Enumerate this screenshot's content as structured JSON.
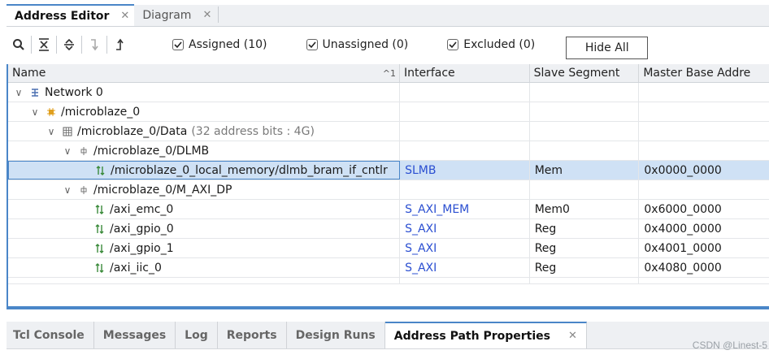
{
  "top_tabs": [
    {
      "label": "Address Editor",
      "active": true
    },
    {
      "label": "Diagram",
      "active": false
    }
  ],
  "toolbar": {
    "checkboxes": [
      {
        "label": "Assigned (10)",
        "checked": true
      },
      {
        "label": "Unassigned (0)",
        "checked": true
      },
      {
        "label": "Excluded (0)",
        "checked": true
      }
    ],
    "hide_all_label": "Hide All"
  },
  "table": {
    "columns": [
      "Name",
      "Interface",
      "Slave Segment",
      "Master Base Addre"
    ],
    "sort_indicator": "^1",
    "rows": [
      {
        "name": "Network 0",
        "interface": "",
        "segment": "",
        "address": ""
      },
      {
        "name": "/microblaze_0",
        "interface": "",
        "segment": "",
        "address": ""
      },
      {
        "name": "/microblaze_0/Data",
        "extra": "(32 address bits : 4G)",
        "interface": "",
        "segment": "",
        "address": ""
      },
      {
        "name": "/microblaze_0/DLMB",
        "interface": "",
        "segment": "",
        "address": ""
      },
      {
        "name": "/microblaze_0_local_memory/dlmb_bram_if_cntlr",
        "interface": "SLMB",
        "segment": "Mem",
        "address": "0x0000_0000"
      },
      {
        "name": "/microblaze_0/M_AXI_DP",
        "interface": "",
        "segment": "",
        "address": ""
      },
      {
        "name": "/axi_emc_0",
        "interface": "S_AXI_MEM",
        "segment": "Mem0",
        "address": "0x6000_0000"
      },
      {
        "name": "/axi_gpio_0",
        "interface": "S_AXI",
        "segment": "Reg",
        "address": "0x4000_0000"
      },
      {
        "name": "/axi_gpio_1",
        "interface": "S_AXI",
        "segment": "Reg",
        "address": "0x4001_0000"
      },
      {
        "name": "/axi_iic_0",
        "interface": "S_AXI",
        "segment": "Reg",
        "address": "0x4080_0000"
      }
    ]
  },
  "bottom_tabs": [
    {
      "label": "Tcl Console",
      "active": false
    },
    {
      "label": "Messages",
      "active": false
    },
    {
      "label": "Log",
      "active": false
    },
    {
      "label": "Reports",
      "active": false
    },
    {
      "label": "Design Runs",
      "active": false
    },
    {
      "label": "Address Path Properties",
      "active": true
    }
  ],
  "watermark": "CSDN @Linest-5",
  "colors": {
    "accent": "#4a86c8",
    "link": "#2b4fd1",
    "selected_row": "#cfe1f5"
  }
}
